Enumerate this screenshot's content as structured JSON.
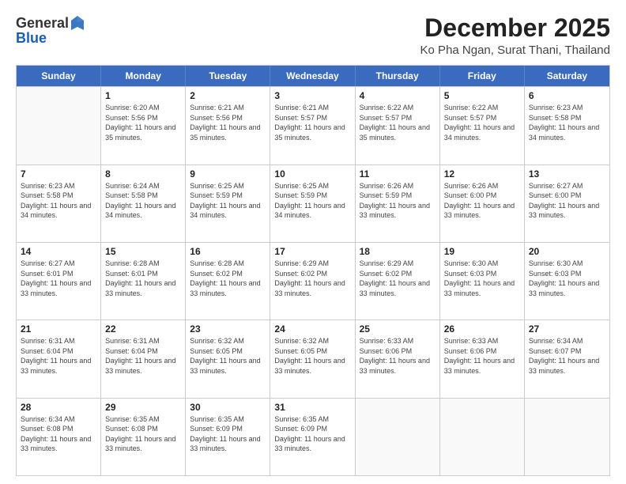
{
  "logo": {
    "general": "General",
    "blue": "Blue"
  },
  "header": {
    "month": "December 2025",
    "location": "Ko Pha Ngan, Surat Thani, Thailand"
  },
  "days_of_week": [
    "Sunday",
    "Monday",
    "Tuesday",
    "Wednesday",
    "Thursday",
    "Friday",
    "Saturday"
  ],
  "weeks": [
    [
      {
        "day": "",
        "sunrise": "",
        "sunset": "",
        "daylight": ""
      },
      {
        "day": "1",
        "sunrise": "Sunrise: 6:20 AM",
        "sunset": "Sunset: 5:56 PM",
        "daylight": "Daylight: 11 hours and 35 minutes."
      },
      {
        "day": "2",
        "sunrise": "Sunrise: 6:21 AM",
        "sunset": "Sunset: 5:56 PM",
        "daylight": "Daylight: 11 hours and 35 minutes."
      },
      {
        "day": "3",
        "sunrise": "Sunrise: 6:21 AM",
        "sunset": "Sunset: 5:57 PM",
        "daylight": "Daylight: 11 hours and 35 minutes."
      },
      {
        "day": "4",
        "sunrise": "Sunrise: 6:22 AM",
        "sunset": "Sunset: 5:57 PM",
        "daylight": "Daylight: 11 hours and 35 minutes."
      },
      {
        "day": "5",
        "sunrise": "Sunrise: 6:22 AM",
        "sunset": "Sunset: 5:57 PM",
        "daylight": "Daylight: 11 hours and 34 minutes."
      },
      {
        "day": "6",
        "sunrise": "Sunrise: 6:23 AM",
        "sunset": "Sunset: 5:58 PM",
        "daylight": "Daylight: 11 hours and 34 minutes."
      }
    ],
    [
      {
        "day": "7",
        "sunrise": "Sunrise: 6:23 AM",
        "sunset": "Sunset: 5:58 PM",
        "daylight": "Daylight: 11 hours and 34 minutes."
      },
      {
        "day": "8",
        "sunrise": "Sunrise: 6:24 AM",
        "sunset": "Sunset: 5:58 PM",
        "daylight": "Daylight: 11 hours and 34 minutes."
      },
      {
        "day": "9",
        "sunrise": "Sunrise: 6:25 AM",
        "sunset": "Sunset: 5:59 PM",
        "daylight": "Daylight: 11 hours and 34 minutes."
      },
      {
        "day": "10",
        "sunrise": "Sunrise: 6:25 AM",
        "sunset": "Sunset: 5:59 PM",
        "daylight": "Daylight: 11 hours and 34 minutes."
      },
      {
        "day": "11",
        "sunrise": "Sunrise: 6:26 AM",
        "sunset": "Sunset: 5:59 PM",
        "daylight": "Daylight: 11 hours and 33 minutes."
      },
      {
        "day": "12",
        "sunrise": "Sunrise: 6:26 AM",
        "sunset": "Sunset: 6:00 PM",
        "daylight": "Daylight: 11 hours and 33 minutes."
      },
      {
        "day": "13",
        "sunrise": "Sunrise: 6:27 AM",
        "sunset": "Sunset: 6:00 PM",
        "daylight": "Daylight: 11 hours and 33 minutes."
      }
    ],
    [
      {
        "day": "14",
        "sunrise": "Sunrise: 6:27 AM",
        "sunset": "Sunset: 6:01 PM",
        "daylight": "Daylight: 11 hours and 33 minutes."
      },
      {
        "day": "15",
        "sunrise": "Sunrise: 6:28 AM",
        "sunset": "Sunset: 6:01 PM",
        "daylight": "Daylight: 11 hours and 33 minutes."
      },
      {
        "day": "16",
        "sunrise": "Sunrise: 6:28 AM",
        "sunset": "Sunset: 6:02 PM",
        "daylight": "Daylight: 11 hours and 33 minutes."
      },
      {
        "day": "17",
        "sunrise": "Sunrise: 6:29 AM",
        "sunset": "Sunset: 6:02 PM",
        "daylight": "Daylight: 11 hours and 33 minutes."
      },
      {
        "day": "18",
        "sunrise": "Sunrise: 6:29 AM",
        "sunset": "Sunset: 6:02 PM",
        "daylight": "Daylight: 11 hours and 33 minutes."
      },
      {
        "day": "19",
        "sunrise": "Sunrise: 6:30 AM",
        "sunset": "Sunset: 6:03 PM",
        "daylight": "Daylight: 11 hours and 33 minutes."
      },
      {
        "day": "20",
        "sunrise": "Sunrise: 6:30 AM",
        "sunset": "Sunset: 6:03 PM",
        "daylight": "Daylight: 11 hours and 33 minutes."
      }
    ],
    [
      {
        "day": "21",
        "sunrise": "Sunrise: 6:31 AM",
        "sunset": "Sunset: 6:04 PM",
        "daylight": "Daylight: 11 hours and 33 minutes."
      },
      {
        "day": "22",
        "sunrise": "Sunrise: 6:31 AM",
        "sunset": "Sunset: 6:04 PM",
        "daylight": "Daylight: 11 hours and 33 minutes."
      },
      {
        "day": "23",
        "sunrise": "Sunrise: 6:32 AM",
        "sunset": "Sunset: 6:05 PM",
        "daylight": "Daylight: 11 hours and 33 minutes."
      },
      {
        "day": "24",
        "sunrise": "Sunrise: 6:32 AM",
        "sunset": "Sunset: 6:05 PM",
        "daylight": "Daylight: 11 hours and 33 minutes."
      },
      {
        "day": "25",
        "sunrise": "Sunrise: 6:33 AM",
        "sunset": "Sunset: 6:06 PM",
        "daylight": "Daylight: 11 hours and 33 minutes."
      },
      {
        "day": "26",
        "sunrise": "Sunrise: 6:33 AM",
        "sunset": "Sunset: 6:06 PM",
        "daylight": "Daylight: 11 hours and 33 minutes."
      },
      {
        "day": "27",
        "sunrise": "Sunrise: 6:34 AM",
        "sunset": "Sunset: 6:07 PM",
        "daylight": "Daylight: 11 hours and 33 minutes."
      }
    ],
    [
      {
        "day": "28",
        "sunrise": "Sunrise: 6:34 AM",
        "sunset": "Sunset: 6:08 PM",
        "daylight": "Daylight: 11 hours and 33 minutes."
      },
      {
        "day": "29",
        "sunrise": "Sunrise: 6:35 AM",
        "sunset": "Sunset: 6:08 PM",
        "daylight": "Daylight: 11 hours and 33 minutes."
      },
      {
        "day": "30",
        "sunrise": "Sunrise: 6:35 AM",
        "sunset": "Sunset: 6:09 PM",
        "daylight": "Daylight: 11 hours and 33 minutes."
      },
      {
        "day": "31",
        "sunrise": "Sunrise: 6:35 AM",
        "sunset": "Sunset: 6:09 PM",
        "daylight": "Daylight: 11 hours and 33 minutes."
      },
      {
        "day": "",
        "sunrise": "",
        "sunset": "",
        "daylight": ""
      },
      {
        "day": "",
        "sunrise": "",
        "sunset": "",
        "daylight": ""
      },
      {
        "day": "",
        "sunrise": "",
        "sunset": "",
        "daylight": ""
      }
    ]
  ]
}
